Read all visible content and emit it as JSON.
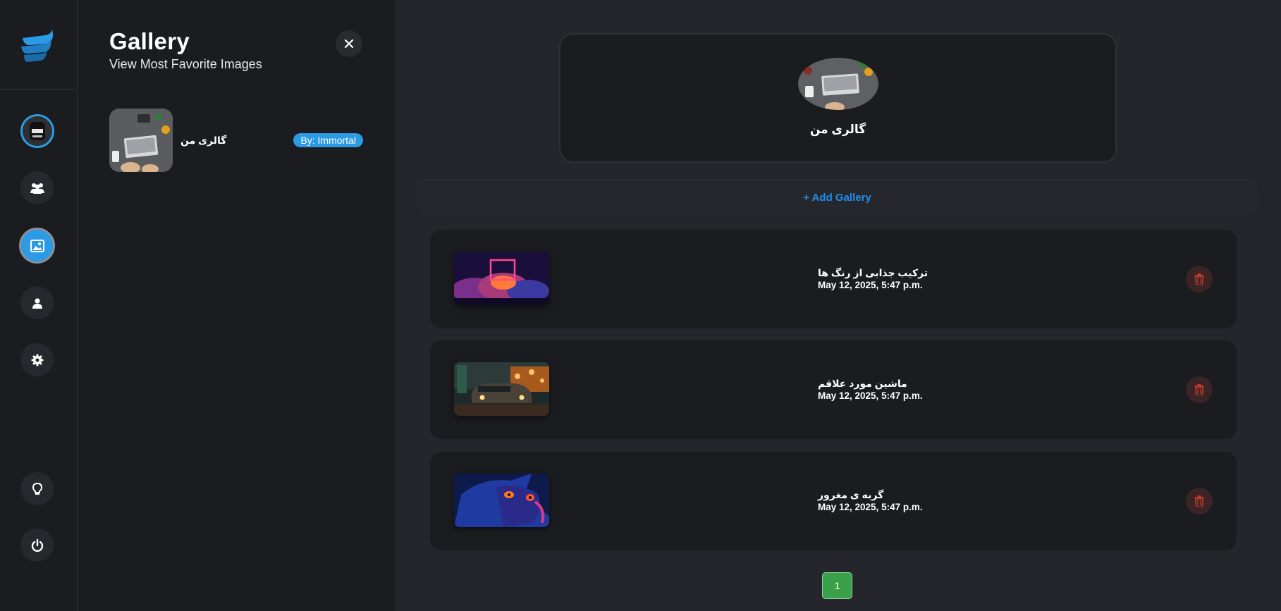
{
  "colors": {
    "accent": "#2b9be4",
    "link": "#1f8ff0",
    "background": "#25262b",
    "panel": "#1b1c20",
    "danger": "#c0392b",
    "pagination_active": "#3aa14a"
  },
  "rail": {
    "logo": "app-logo",
    "items": [
      {
        "icon": "user-avatar",
        "active": false
      },
      {
        "icon": "users-icon",
        "active": false
      },
      {
        "icon": "image-icon",
        "active": true
      },
      {
        "icon": "user-icon",
        "active": false
      },
      {
        "icon": "gear-icon",
        "active": false
      },
      {
        "icon": "lightbulb-icon",
        "active": false
      },
      {
        "icon": "power-icon",
        "active": false
      }
    ]
  },
  "panel": {
    "title": "Gallery",
    "subtitle": "View Most Favorite Images",
    "close_icon": "close-icon",
    "items": [
      {
        "name": "گالری من",
        "author": "By: Immortal"
      }
    ]
  },
  "main": {
    "hero": {
      "name": "گالری من"
    },
    "add_label": "+ Add Gallery",
    "images": [
      {
        "title": "ترکیب جذابی از رنگ ها",
        "date": "May 12, 2025, 5:47 p.m.",
        "thumb": "neon-cloud-image"
      },
      {
        "title": "ماشین مورد علاقم",
        "date": "May 12, 2025, 5:47 p.m.",
        "thumb": "car-night-image"
      },
      {
        "title": "گربه ی مغرور",
        "date": "May 12, 2025, 5:47 p.m.",
        "thumb": "blue-cat-image"
      }
    ],
    "pagination": {
      "current": "1"
    }
  }
}
